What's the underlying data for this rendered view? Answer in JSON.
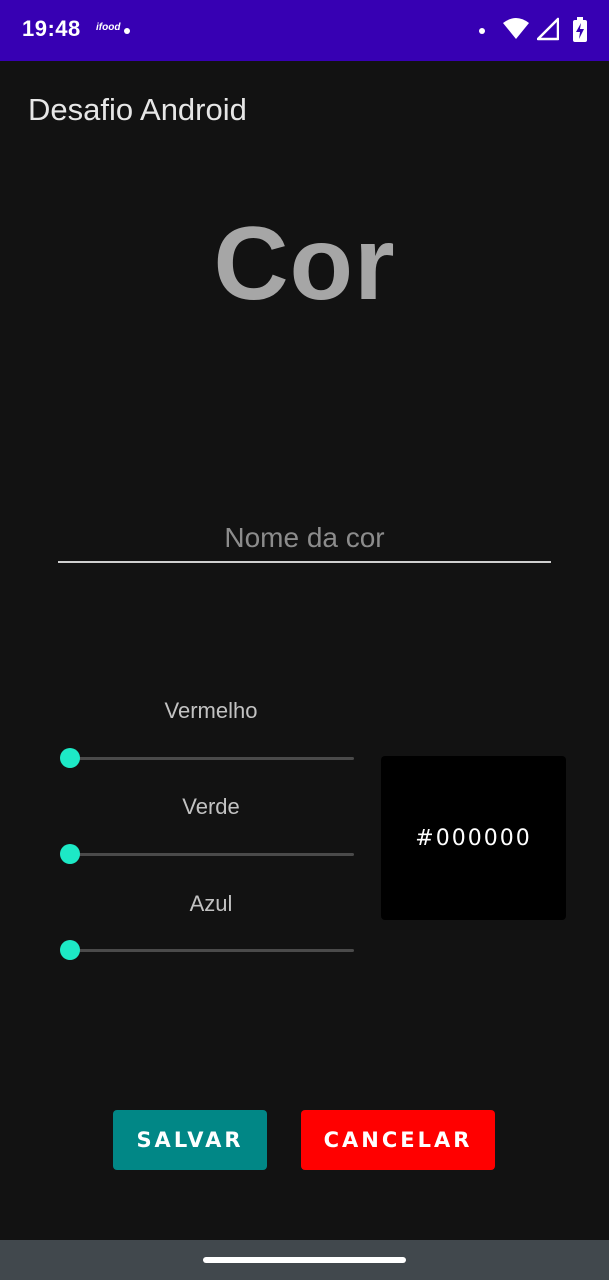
{
  "status_bar": {
    "time": "19:48",
    "notification_app": "ifood",
    "background_color": "#3700b3",
    "icons": [
      "dot-icon",
      "wifi-icon",
      "cellular-signal-icon",
      "battery-charging-icon"
    ]
  },
  "app_bar": {
    "title": "Desafio Android"
  },
  "heading": {
    "text": "Cor"
  },
  "name_field": {
    "value": "",
    "placeholder": "Nome da cor"
  },
  "sliders": [
    {
      "label": "Vermelho",
      "value": 0,
      "min": 0,
      "max": 255
    },
    {
      "label": "Verde",
      "value": 0,
      "min": 0,
      "max": 255
    },
    {
      "label": "Azul",
      "value": 0,
      "min": 0,
      "max": 255
    }
  ],
  "slider_accent_color": "#1de9c6",
  "preview": {
    "hex_text": "#000000",
    "color": "#000000"
  },
  "buttons": {
    "save_label": "SALVAR",
    "save_color": "#018786",
    "cancel_label": "CANCELAR",
    "cancel_color": "#ff0000"
  },
  "nav_bar": {
    "handle": "gesture-handle"
  }
}
